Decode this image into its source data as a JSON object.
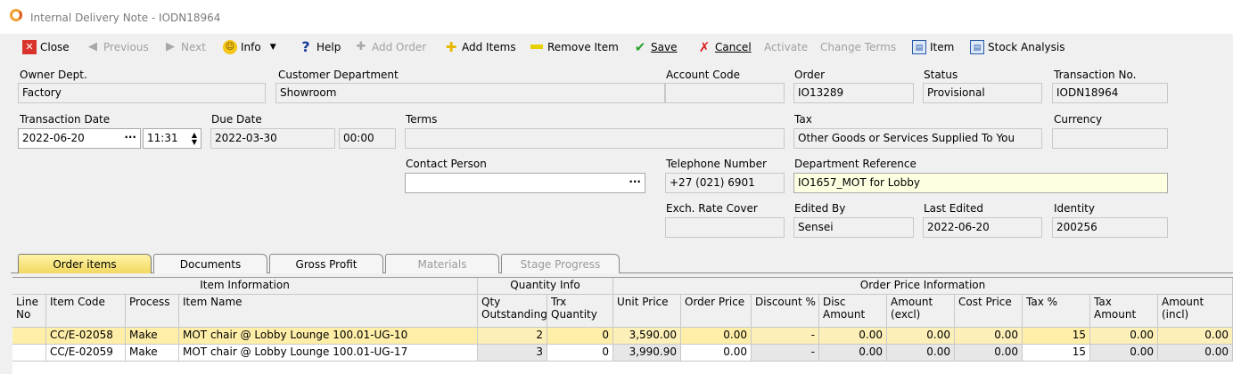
{
  "window": {
    "title": "Internal Delivery Note - IODN18964"
  },
  "toolbar": {
    "close": "Close",
    "previous": "Previous",
    "next": "Next",
    "info": "Info",
    "help": "Help",
    "add_order": "Add Order",
    "add_items": "Add Items",
    "remove_item": "Remove Item",
    "save": "Save",
    "cancel": "Cancel",
    "activate": "Activate",
    "change_terms": "Change Terms",
    "item": "Item",
    "stock_analysis": "Stock Analysis"
  },
  "form": {
    "owner_dept": {
      "label": "Owner Dept.",
      "value": "Factory"
    },
    "customer_department": {
      "label": "Customer Department",
      "value": "Showroom"
    },
    "account_code": {
      "label": "Account Code",
      "value": ""
    },
    "order": {
      "label": "Order",
      "value": "IO13289"
    },
    "status": {
      "label": "Status",
      "value": "Provisional"
    },
    "transaction_no": {
      "label": "Transaction No.",
      "value": "IODN18964"
    },
    "transaction_date": {
      "label": "Transaction Date",
      "value": "2022-06-20",
      "time": "11:31"
    },
    "due_date": {
      "label": "Due Date",
      "value": "2022-03-30",
      "time": "00:00"
    },
    "terms": {
      "label": "Terms",
      "value": ""
    },
    "tax": {
      "label": "Tax",
      "value": "Other Goods or Services Supplied To You"
    },
    "currency": {
      "label": "Currency",
      "value": ""
    },
    "contact_person": {
      "label": "Contact Person",
      "value": ""
    },
    "telephone_number": {
      "label": "Telephone Number",
      "value": "+27 (021) 6901"
    },
    "department_reference": {
      "label": "Department Reference",
      "value": "IO1657_MOT for Lobby"
    },
    "exch_rate_cover": {
      "label": "Exch. Rate Cover",
      "value": ""
    },
    "edited_by": {
      "label": "Edited By",
      "value": "Sensei"
    },
    "last_edited": {
      "label": "Last Edited",
      "value": "2022-06-20"
    },
    "identity": {
      "label": "Identity",
      "value": "200256"
    }
  },
  "tabs": [
    "Order items",
    "Documents",
    "Gross Profit",
    "Materials",
    "Stage Progress"
  ],
  "grid": {
    "groups": {
      "item_info": "Item Information",
      "quantity_info": "Quantity Info",
      "order_price_info": "Order Price Information"
    },
    "columns": {
      "line_no": "Line No",
      "item_code": "Item Code",
      "process": "Process",
      "item_name": "Item Name",
      "qty_outstanding": "Qty Outstanding",
      "trx_quantity": "Trx Quantity",
      "unit_price": "Unit Price",
      "order_price": "Order Price",
      "discount_pct": "Discount %",
      "disc_amount": "Disc Amount",
      "amount_excl": "Amount (excl)",
      "cost_price": "Cost Price",
      "tax_pct": "Tax %",
      "tax_amount": "Tax Amount",
      "amount_incl": "Amount (incl)"
    },
    "rows": [
      {
        "line_no": "",
        "item_code": "CC/E-02058",
        "process": "Make",
        "item_name": "MOT chair @ Lobby Lounge 100.01-UG-10",
        "qty_outstanding": "2",
        "trx_quantity": "0",
        "unit_price": "3,590.00",
        "order_price": "0.00",
        "discount_pct": "-",
        "disc_amount": "0.00",
        "amount_excl": "0.00",
        "cost_price": "0.00",
        "tax_pct": "15",
        "tax_amount": "0.00",
        "amount_incl": "0.00"
      },
      {
        "line_no": "",
        "item_code": "CC/E-02059",
        "process": "Make",
        "item_name": "MOT chair @ Lobby Lounge 100.01-UG-17",
        "qty_outstanding": "3",
        "trx_quantity": "0",
        "unit_price": "3,990.90",
        "order_price": "0.00",
        "discount_pct": "-",
        "disc_amount": "0.00",
        "amount_excl": "0.00",
        "cost_price": "0.00",
        "tax_pct": "15",
        "tax_amount": "0.00",
        "amount_incl": "0.00"
      }
    ]
  },
  "colors": {
    "selected_row": "#ffeea8",
    "active_tab": "#f2d860"
  }
}
